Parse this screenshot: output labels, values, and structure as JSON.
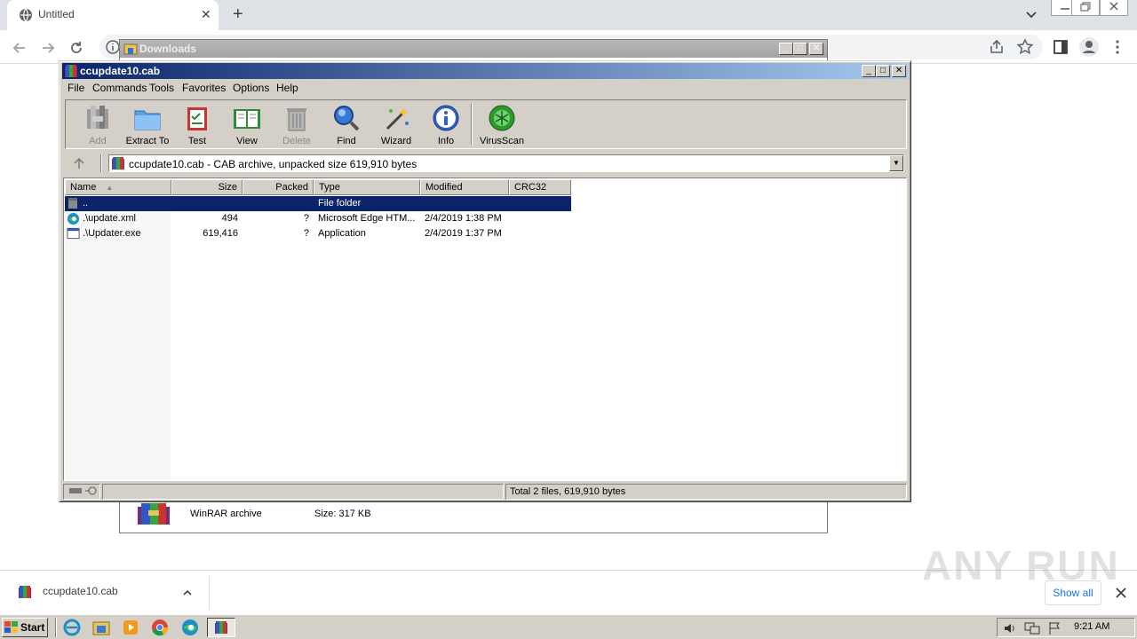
{
  "browser": {
    "tab_title": "Untitled",
    "tab_close": "✕",
    "new_tab": "+",
    "nav": {
      "back": "←",
      "forward": "→",
      "reload": "↻",
      "info": "ⓘ"
    }
  },
  "downloads_window": {
    "title": "Downloads",
    "file_type": "WinRAR archive",
    "file_size": "Size: 317 KB"
  },
  "winrar": {
    "title": "ccupdate10.cab",
    "menu": [
      "File",
      "Commands",
      "Tools",
      "Favorites",
      "Options",
      "Help"
    ],
    "toolbar": [
      {
        "label": "Add",
        "icon": "add-icon",
        "disabled": true
      },
      {
        "label": "Extract To",
        "icon": "extract-folder-icon",
        "disabled": false
      },
      {
        "label": "Test",
        "icon": "test-clipboard-icon",
        "disabled": false
      },
      {
        "label": "View",
        "icon": "view-book-icon",
        "disabled": false
      },
      {
        "label": "Delete",
        "icon": "trash-icon",
        "disabled": true
      },
      {
        "label": "Find",
        "icon": "magnifier-icon",
        "disabled": false
      },
      {
        "label": "Wizard",
        "icon": "wand-icon",
        "disabled": false
      },
      {
        "label": "Info",
        "icon": "info-icon",
        "disabled": false
      },
      {
        "label": "VirusScan",
        "icon": "virus-icon",
        "disabled": false
      }
    ],
    "address": "ccupdate10.cab - CAB archive, unpacked size 619,910 bytes",
    "columns": [
      "Name",
      "Size",
      "Packed",
      "Type",
      "Modified",
      "CRC32"
    ],
    "rows": [
      {
        "name": "..",
        "size": "",
        "packed": "",
        "type": "File folder",
        "modified": "",
        "crc": "",
        "selected": true
      },
      {
        "name": ".\\update.xml",
        "size": "494",
        "packed": "?",
        "type": "Microsoft Edge HTM...",
        "modified": "2/4/2019 1:38 PM",
        "crc": "",
        "selected": false
      },
      {
        "name": ".\\Updater.exe",
        "size": "619,416",
        "packed": "?",
        "type": "Application",
        "modified": "2/4/2019 1:37 PM",
        "crc": "",
        "selected": false
      }
    ],
    "status": "Total 2 files, 619,910 bytes"
  },
  "shelf": {
    "file_name": "ccupdate10.cab",
    "show_all": "Show all"
  },
  "watermark": "ANY RUN",
  "taskbar": {
    "start": "Start",
    "clock": "9:21 AM"
  }
}
